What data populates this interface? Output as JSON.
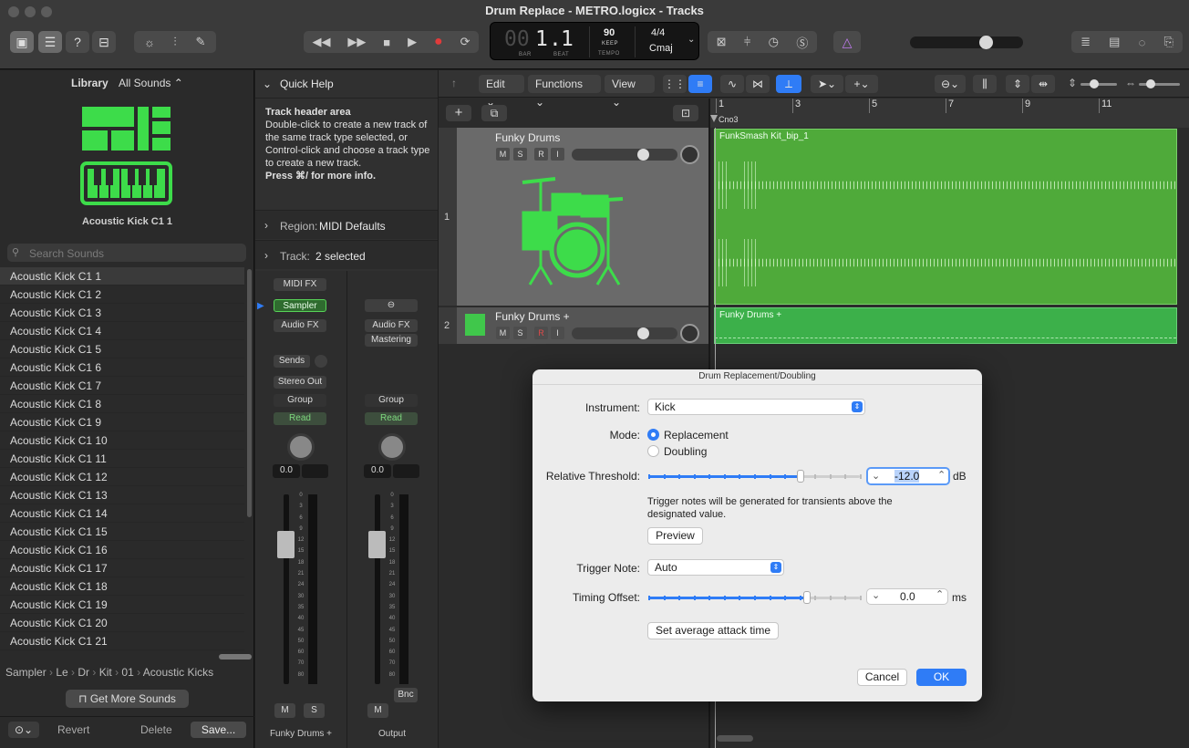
{
  "window": {
    "title": "Drum Replace - METRO.logicx - Tracks"
  },
  "lcd": {
    "bar": "1",
    "beat": "1",
    "prefix": "00",
    "bar_label": "BAR",
    "beat_label": "BEAT",
    "tempo": "90",
    "keep": "KEEP",
    "tempo_label": "TEMPO",
    "signature": "4/4",
    "key": "Cmaj"
  },
  "library": {
    "header_label": "Library",
    "filter": "All Sounds",
    "patch_name": "Acoustic Kick C1 1",
    "search_placeholder": "Search Sounds",
    "items": [
      "Acoustic Kick C1 1",
      "Acoustic Kick C1 2",
      "Acoustic Kick C1 3",
      "Acoustic Kick C1 4",
      "Acoustic Kick C1 5",
      "Acoustic Kick C1 6",
      "Acoustic Kick C1 7",
      "Acoustic Kick C1 8",
      "Acoustic Kick C1 9",
      "Acoustic Kick C1 10",
      "Acoustic Kick C1 11",
      "Acoustic Kick C1 12",
      "Acoustic Kick C1 13",
      "Acoustic Kick C1 14",
      "Acoustic Kick C1 15",
      "Acoustic Kick C1 16",
      "Acoustic Kick C1 17",
      "Acoustic Kick C1 18",
      "Acoustic Kick C1 19",
      "Acoustic Kick C1 20",
      "Acoustic Kick C1 21"
    ],
    "breadcrumb": [
      "Sampler",
      "Le",
      "Dr",
      "Kit",
      "01",
      "Acoustic Kicks"
    ],
    "get_more": "Get More Sounds",
    "revert": "Revert",
    "delete": "Delete",
    "save": "Save..."
  },
  "quick_help": {
    "title": "Quick Help",
    "heading": "Track header area",
    "body": "Double-click to create a new track of the same track type selected, or Control-click and choose a track type to create a new track.",
    "hint": "Press ⌘/ for more info.",
    "region_label": "Region:",
    "region_value": "MIDI Defaults",
    "track_label": "Track:",
    "track_value": "2 selected"
  },
  "mixer": {
    "midi_fx": "MIDI FX",
    "sampler": "Sampler",
    "audio_fx": "Audio FX",
    "audio_fx2": "Audio FX",
    "mastering": "Mastering",
    "sends": "Sends",
    "stereo_out": "Stereo Out",
    "group": "Group",
    "read": "Read",
    "pan_value": "0.0",
    "fader_scale": [
      "0",
      "3",
      "6",
      "9",
      "12",
      "15",
      "18",
      "21",
      "24",
      "30",
      "35",
      "40",
      "45",
      "50",
      "60",
      "70",
      "80"
    ],
    "m": "M",
    "s": "S",
    "bnc": "Bnc",
    "strip1_name": "Funky Drums +",
    "strip2_name": "Output"
  },
  "tracks_toolbar": {
    "edit": "Edit",
    "functions": "Functions",
    "view": "View"
  },
  "ruler": {
    "marks": [
      "1",
      "3",
      "5",
      "7",
      "9",
      "11"
    ],
    "region_ruler_label": "Cno3"
  },
  "track_headers": [
    {
      "number": "1",
      "name": "Funky Drums",
      "buttons": [
        "M",
        "S",
        "R",
        "I"
      ]
    },
    {
      "number": "2",
      "name": "Funky Drums +",
      "buttons": [
        "M",
        "S",
        "R",
        "I"
      ]
    }
  ],
  "regions": [
    {
      "name": "FunkSmash Kit_bip_1",
      "color": "#4faa3a"
    },
    {
      "name": "Funky Drums +",
      "color": "#3cb04a"
    }
  ],
  "dialog": {
    "title": "Drum Replacement/Doubling",
    "instrument_label": "Instrument:",
    "instrument_value": "Kick",
    "mode_label": "Mode:",
    "mode_replacement": "Replacement",
    "mode_doubling": "Doubling",
    "threshold_label": "Relative Threshold:",
    "threshold_value": "-12.0",
    "threshold_unit": "dB",
    "threshold_fraction": 0.72,
    "info_text": "Trigger notes will be generated for transients above the designated value.",
    "preview": "Preview",
    "trigger_label": "Trigger Note:",
    "trigger_value": "Auto",
    "timing_label": "Timing Offset:",
    "timing_value": "0.0",
    "timing_unit": "ms",
    "timing_fraction": 0.75,
    "avg_attack": "Set average attack time",
    "cancel": "Cancel",
    "ok": "OK"
  },
  "colors": {
    "accent": "#2f7cf6",
    "region_green": "#4faa3a",
    "icon_green": "#3ddc4a"
  }
}
